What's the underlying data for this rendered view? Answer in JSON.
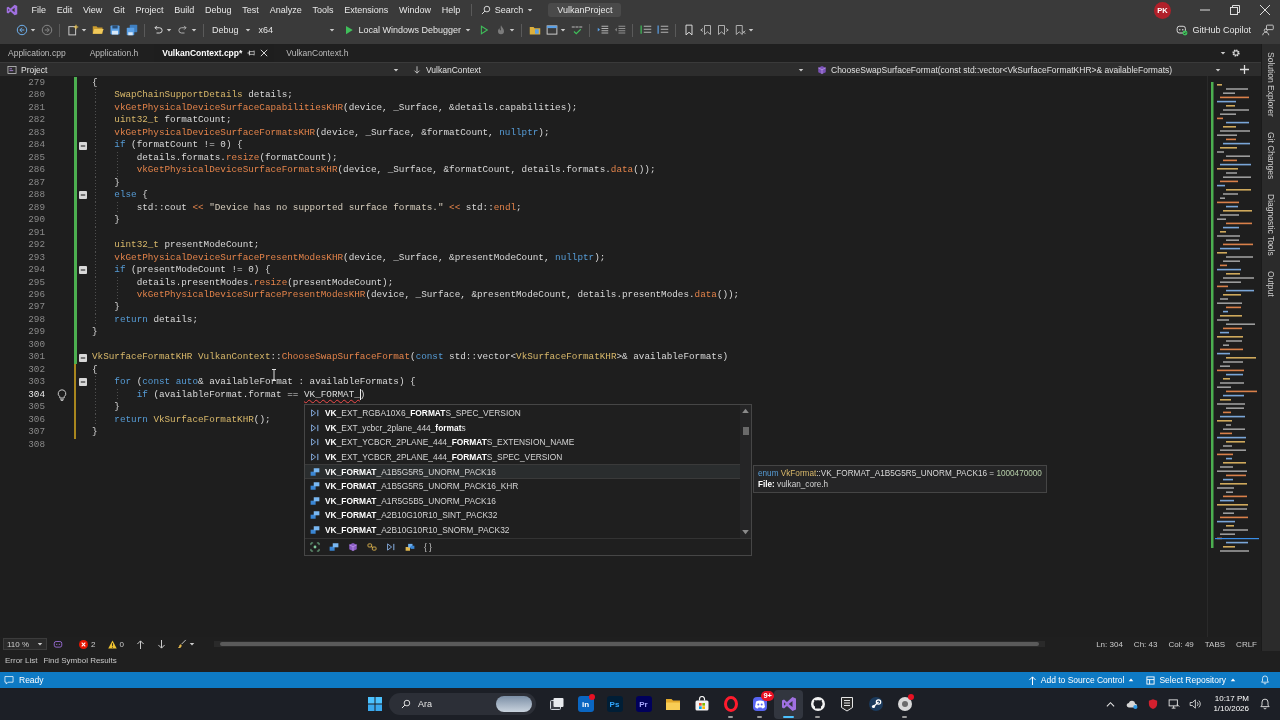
{
  "title_bar": {
    "menu": [
      "File",
      "Edit",
      "View",
      "Git",
      "Project",
      "Build",
      "Debug",
      "Test",
      "Analyze",
      "Tools",
      "Extensions",
      "Window",
      "Help"
    ],
    "search": "Search",
    "solution": "VulkanProject",
    "account": "PK"
  },
  "toolbar": {
    "items": [
      {
        "kind": "back",
        "disabled": false,
        "menu": true
      },
      {
        "kind": "forward",
        "disabled": true,
        "menu": false
      },
      {
        "kind": "separator"
      },
      {
        "kind": "new_item",
        "disabled": false,
        "menu": true
      },
      {
        "kind": "open",
        "disabled": false,
        "menu": false
      },
      {
        "kind": "save",
        "disabled": false,
        "menu": false
      },
      {
        "kind": "save_all",
        "disabled": false,
        "menu": false
      },
      {
        "kind": "separator"
      },
      {
        "kind": "undo",
        "disabled": false,
        "menu": true
      },
      {
        "kind": "redo",
        "disabled": true,
        "menu": true
      },
      {
        "kind": "separator"
      },
      {
        "kind": "combo",
        "label": "Debug"
      },
      {
        "kind": "combo",
        "label": "x64"
      },
      {
        "kind": "run",
        "label": "Local Windows Debugger",
        "menu": true
      },
      {
        "kind": "run_outline",
        "disabled": false,
        "menu": false
      },
      {
        "kind": "hot_reload",
        "disabled": true,
        "menu": true
      },
      {
        "kind": "separator"
      },
      {
        "kind": "solution_folder",
        "disabled": false,
        "menu": false
      },
      {
        "kind": "window",
        "disabled": false,
        "menu": true
      },
      {
        "kind": "spell",
        "disabled": false,
        "menu": false
      },
      {
        "kind": "separator"
      },
      {
        "kind": "indent",
        "disabled": false,
        "menu": false
      },
      {
        "kind": "outdent",
        "disabled": true,
        "menu": false
      },
      {
        "kind": "separator"
      },
      {
        "kind": "comment",
        "disabled": false,
        "menu": false
      },
      {
        "kind": "uncomment",
        "disabled": false,
        "menu": false
      },
      {
        "kind": "separator"
      },
      {
        "kind": "bookmark",
        "disabled": false,
        "menu": false
      },
      {
        "kind": "bookmark_prev",
        "disabled": true,
        "menu": false
      },
      {
        "kind": "bookmark_next",
        "disabled": true,
        "menu": false
      },
      {
        "kind": "bookmark_clear",
        "disabled": true,
        "menu": true
      }
    ],
    "copilot": "GitHub Copilot"
  },
  "tabs": [
    {
      "label": "Application.cpp",
      "selected": false
    },
    {
      "label": "Application.h",
      "selected": false
    },
    {
      "label": "VulkanContext.cpp*",
      "selected": true
    },
    {
      "label": "VulkanContext.h",
      "selected": false
    }
  ],
  "navigation": {
    "project": "Project",
    "scope": "VulkanContext",
    "member": "ChooseSwapSurfaceFormat(const std::vector<VkSurfaceFormatKHR>& availableFormats)"
  },
  "editor": {
    "lines": [
      {
        "number": "279",
        "fold": false,
        "current": false,
        "lightbulb": false,
        "changed": true,
        "saved": true,
        "tokens": [
          {
            "kind": "plain",
            "text": "{"
          }
        ],
        "children": [
          {
            "number": "280",
            "fold": false,
            "current": false,
            "lightbulb": false,
            "changed": true,
            "saved": true,
            "tokens": [
              {
                "kind": "type",
                "text": "SwapChainSupportDetails"
              },
              {
                "kind": "plain",
                "text": " details;"
              }
            ]
          },
          {
            "number": "281",
            "fold": false,
            "current": false,
            "lightbulb": false,
            "changed": true,
            "saved": true,
            "tokens": [
              {
                "kind": "function",
                "text": "vkGetPhysicalDeviceSurfaceCapabilitiesKHR"
              },
              {
                "kind": "plain",
                "text": "(device, _Surface, &details.capabilities);"
              }
            ]
          },
          {
            "number": "282",
            "fold": false,
            "current": false,
            "lightbulb": false,
            "changed": true,
            "saved": true,
            "tokens": [
              {
                "kind": "type",
                "text": "uint32_t"
              },
              {
                "kind": "plain",
                "text": " formatCount;"
              }
            ]
          },
          {
            "number": "283",
            "fold": false,
            "current": false,
            "lightbulb": false,
            "changed": true,
            "saved": true,
            "tokens": [
              {
                "kind": "function",
                "text": "vkGetPhysicalDeviceSurfaceFormatsKHR"
              },
              {
                "kind": "plain",
                "text": "(device, _Surface, &formatCount, "
              },
              {
                "kind": "keyword",
                "text": "nullptr"
              },
              {
                "kind": "plain",
                "text": ");"
              }
            ]
          },
          {
            "number": "284",
            "fold": true,
            "current": false,
            "lightbulb": false,
            "changed": true,
            "saved": true,
            "tokens": [
              {
                "kind": "keyword",
                "text": "if"
              },
              {
                "kind": "plain",
                "text": " (formatCount != 0) {"
              }
            ],
            "children": [
              {
                "number": "285",
                "fold": false,
                "current": false,
                "lightbulb": false,
                "changed": true,
                "saved": true,
                "tokens": [
                  {
                    "kind": "plain",
                    "text": "details.formats."
                  },
                  {
                    "kind": "function",
                    "text": "resize"
                  },
                  {
                    "kind": "plain",
                    "text": "(formatCount);"
                  }
                ]
              },
              {
                "number": "286",
                "fold": false,
                "current": false,
                "lightbulb": false,
                "changed": true,
                "saved": true,
                "tokens": [
                  {
                    "kind": "function",
                    "text": "vkGetPhysicalDeviceSurfaceFormatsKHR"
                  },
                  {
                    "kind": "plain",
                    "text": "(device, _Surface, &formatCount, details.formats."
                  },
                  {
                    "kind": "function",
                    "text": "data"
                  },
                  {
                    "kind": "plain",
                    "text": "());"
                  }
                ]
              }
            ]
          },
          {
            "number": "287",
            "fold": false,
            "current": false,
            "lightbulb": false,
            "changed": true,
            "saved": true,
            "tokens": [
              {
                "kind": "plain",
                "text": "}"
              }
            ]
          },
          {
            "number": "288",
            "fold": true,
            "current": false,
            "lightbulb": false,
            "changed": true,
            "saved": true,
            "tokens": [
              {
                "kind": "keyword",
                "text": "else"
              },
              {
                "kind": "plain",
                "text": " {"
              }
            ],
            "children": [
              {
                "number": "289",
                "fold": false,
                "current": false,
                "lightbulb": false,
                "changed": true,
                "saved": true,
                "tokens": [
                  {
                    "kind": "plain",
                    "text": "std::cout "
                  },
                  {
                    "kind": "operator",
                    "text": "<< "
                  },
                  {
                    "kind": "string",
                    "text": "\"Device has no supported surface formats.\" "
                  },
                  {
                    "kind": "operator",
                    "text": "<<"
                  },
                  {
                    "kind": "plain",
                    "text": " std::"
                  },
                  {
                    "kind": "function",
                    "text": "endl"
                  },
                  {
                    "kind": "plain",
                    "text": ";"
                  }
                ]
              }
            ]
          },
          {
            "number": "290",
            "fold": false,
            "current": false,
            "lightbulb": false,
            "changed": true,
            "saved": true,
            "tokens": [
              {
                "kind": "plain",
                "text": "}"
              }
            ]
          },
          {
            "number": "291",
            "fold": false,
            "current": false,
            "lightbulb": false,
            "changed": true,
            "saved": true
          },
          {
            "number": "292",
            "fold": false,
            "current": false,
            "lightbulb": false,
            "changed": true,
            "saved": true,
            "tokens": [
              {
                "kind": "type",
                "text": "uint32_t"
              },
              {
                "kind": "plain",
                "text": " presentModeCount;"
              }
            ]
          },
          {
            "number": "293",
            "fold": false,
            "current": false,
            "lightbulb": false,
            "changed": true,
            "saved": true,
            "tokens": [
              {
                "kind": "function",
                "text": "vkGetPhysicalDeviceSurfacePresentModesKHR"
              },
              {
                "kind": "plain",
                "text": "(device, _Surface, &presentModeCount, "
              },
              {
                "kind": "keyword",
                "text": "nullptr"
              },
              {
                "kind": "plain",
                "text": ");"
              }
            ]
          },
          {
            "number": "294",
            "fold": true,
            "current": false,
            "lightbulb": false,
            "changed": true,
            "saved": true,
            "tokens": [
              {
                "kind": "keyword",
                "text": "if"
              },
              {
                "kind": "plain",
                "text": " (presentModeCount != 0) {"
              }
            ],
            "children": [
              {
                "number": "295",
                "fold": false,
                "current": false,
                "lightbulb": false,
                "changed": true,
                "saved": true,
                "tokens": [
                  {
                    "kind": "plain",
                    "text": "details.presentModes."
                  },
                  {
                    "kind": "function",
                    "text": "resize"
                  },
                  {
                    "kind": "plain",
                    "text": "(presentModeCount);"
                  }
                ]
              },
              {
                "number": "296",
                "fold": false,
                "current": false,
                "lightbulb": false,
                "changed": true,
                "saved": true,
                "tokens": [
                  {
                    "kind": "function",
                    "text": "vkGetPhysicalDeviceSurfacePresentModesKHR"
                  },
                  {
                    "kind": "plain",
                    "text": "(device, _Surface, &presentModeCount, details.presentModes."
                  },
                  {
                    "kind": "function",
                    "text": "data"
                  },
                  {
                    "kind": "plain",
                    "text": "());"
                  }
                ]
              }
            ]
          },
          {
            "number": "297",
            "fold": false,
            "current": false,
            "lightbulb": false,
            "changed": true,
            "saved": true,
            "tokens": [
              {
                "kind": "plain",
                "text": "}"
              }
            ]
          },
          {
            "number": "298",
            "fold": false,
            "current": false,
            "lightbulb": false,
            "changed": true,
            "saved": true,
            "tokens": [
              {
                "kind": "keyword",
                "text": "return"
              },
              {
                "kind": "plain",
                "text": " details;"
              }
            ]
          }
        ]
      },
      {
        "number": "299",
        "fold": false,
        "current": false,
        "lightbulb": false,
        "changed": true,
        "saved": true,
        "tokens": [
          {
            "kind": "plain",
            "text": "}"
          }
        ]
      },
      {
        "number": "300",
        "fold": false,
        "current": false,
        "lightbulb": false,
        "changed": true,
        "saved": true
      },
      {
        "number": "301",
        "fold": true,
        "current": false,
        "lightbulb": false,
        "changed": true,
        "saved": true,
        "tokens": [
          {
            "kind": "type",
            "text": "VkSurfaceFormatKHR VulkanContext"
          },
          {
            "kind": "plain",
            "text": "::"
          },
          {
            "kind": "function",
            "text": "ChooseSwapSurfaceFormat"
          },
          {
            "kind": "plain",
            "text": "("
          },
          {
            "kind": "keyword",
            "text": "const"
          },
          {
            "kind": "plain",
            "text": " std::vector<"
          },
          {
            "kind": "type",
            "text": "VkSurfaceFormatKHR"
          },
          {
            "kind": "plain",
            "text": ">& availableFormats)"
          }
        ]
      },
      {
        "number": "302",
        "fold": false,
        "current": false,
        "lightbulb": false,
        "changed": true,
        "saved": false,
        "tokens": [
          {
            "kind": "plain",
            "text": "{"
          }
        ],
        "children": [
          {
            "number": "303",
            "fold": true,
            "current": false,
            "lightbulb": false,
            "changed": true,
            "saved": false,
            "tokens": [
              {
                "kind": "keyword",
                "text": "for"
              },
              {
                "kind": "plain",
                "text": " ("
              },
              {
                "kind": "keyword",
                "text": "const auto"
              },
              {
                "kind": "plain",
                "text": "& availableFormat : availableFormats) {"
              }
            ],
            "children": [
              {
                "number": "304",
                "fold": false,
                "current": true,
                "lightbulb": true,
                "changed": true,
                "saved": false,
                "tokens": [
                  {
                    "kind": "keyword",
                    "text": "if"
                  },
                  {
                    "kind": "plain",
                    "text": " (availableFormat.format == "
                  },
                  {
                    "kind": "error",
                    "text": "VK_FORMAT_",
                    "caret": true
                  },
                  {
                    "kind": "plain",
                    "text": ")"
                  }
                ]
              }
            ]
          },
          {
            "number": "305",
            "fold": false,
            "current": false,
            "lightbulb": false,
            "changed": true,
            "saved": false,
            "tokens": [
              {
                "kind": "plain",
                "text": "}"
              }
            ]
          },
          {
            "number": "306",
            "fold": false,
            "current": false,
            "lightbulb": false,
            "changed": true,
            "saved": false,
            "tokens": [
              {
                "kind": "keyword",
                "text": "return "
              },
              {
                "kind": "type",
                "text": "VkSurfaceFormatKHR"
              },
              {
                "kind": "plain",
                "text": "();"
              }
            ]
          }
        ]
      },
      {
        "number": "307",
        "fold": false,
        "current": false,
        "lightbulb": false,
        "changed": true,
        "saved": false,
        "tokens": [
          {
            "kind": "plain",
            "text": "}"
          }
        ]
      },
      {
        "number": "308",
        "fold": false,
        "current": false,
        "lightbulb": false,
        "changed": false
      }
    ]
  },
  "completion": {
    "items": [
      {
        "kind": "constant",
        "label": "**VK**_EXT_RGBA10X6_**FORMAT**S_SPEC_VERSION",
        "selected": false
      },
      {
        "kind": "constant",
        "label": "**VK**_EXT_ycbcr_2plane_444_**format**s",
        "selected": false
      },
      {
        "kind": "constant",
        "label": "**VK**_EXT_YCBCR_2PLANE_444_**FORMAT**S_EXTENSION_NAME",
        "selected": false
      },
      {
        "kind": "constant",
        "label": "**VK**_EXT_YCBCR_2PLANE_444_**FORMAT**S_SPEC_VERSION",
        "selected": false
      },
      {
        "kind": "enum_member",
        "label": "**VK_FORMAT**_A1B5G5R5_UNORM_PACK16",
        "selected": true
      },
      {
        "kind": "enum_member",
        "label": "**VK_FORMAT**_A1B5G5R5_UNORM_PACK16_KHR",
        "selected": false
      },
      {
        "kind": "enum_member",
        "label": "**VK_FORMAT**_A1R5G5B5_UNORM_PACK16",
        "selected": false
      },
      {
        "kind": "enum_member",
        "label": "**VK_FORMAT**_A2B10G10R10_SINT_PACK32",
        "selected": false
      },
      {
        "kind": "enum_member",
        "label": "**VK_FORMAT**_A2B10G10R10_SNORM_PACK32",
        "selected": false
      }
    ],
    "filters": [
      {
        "kind": "all"
      },
      {
        "kind": "enum_member"
      },
      {
        "kind": "class"
      },
      {
        "kind": "link"
      },
      {
        "kind": "constant"
      },
      {
        "kind": "enum"
      },
      {
        "kind": "snippet",
        "label": "{ }"
      }
    ]
  },
  "tooltip": {
    "signature": [
      {
        "kind": "keyword",
        "text": "enum "
      },
      {
        "kind": "type",
        "text": "VkFormat"
      },
      {
        "kind": "plain",
        "text": "::VK_FORMAT_A1B5G5R5_UNORM_PACK16 = "
      },
      {
        "kind": "number",
        "text": "1000470000"
      }
    ],
    "file": "**File:** vulkan_core.h"
  },
  "tool_windows": [
    "Solution Explorer",
    "Git Changes",
    "Diagnostic Tools",
    "Output"
  ],
  "editor_status": {
    "zoom": "110 %",
    "errors": "2",
    "warnings": "0",
    "position": [
      "Ln: 304",
      "Ch: 43",
      "Col: 49"
    ],
    "indentation": "TABS",
    "line_ending": "CRLF"
  },
  "bottom_tabs": [
    "Error List",
    "Find Symbol Results"
  ],
  "status_bar": {
    "message": "Ready",
    "source_control": "Add to Source Control",
    "repository": "Select Repository"
  },
  "taskbar": {
    "search": {
      "placeholder": "Ara"
    },
    "apps": [
      {
        "kind": "task_view",
        "running": false,
        "selected": false,
        "dot": false
      },
      {
        "kind": "linkedin",
        "label": "in",
        "running": false,
        "selected": false,
        "dot": true
      },
      {
        "kind": "photoshop",
        "label": "Ps",
        "running": false,
        "selected": false,
        "dot": false
      },
      {
        "kind": "premiere",
        "label": "Pr",
        "running": false,
        "selected": false,
        "dot": false
      },
      {
        "kind": "explorer",
        "running": false,
        "selected": false,
        "dot": false
      },
      {
        "kind": "store",
        "running": false,
        "selected": false,
        "dot": false
      },
      {
        "kind": "opera",
        "running": true,
        "selected": false,
        "dot": false
      },
      {
        "kind": "discord",
        "badge": "9+",
        "running": true,
        "selected": false,
        "dot": false
      },
      {
        "kind": "visual_studio",
        "running": true,
        "selected": true,
        "dot": false
      },
      {
        "kind": "github",
        "running": true,
        "selected": false,
        "dot": false
      },
      {
        "kind": "epic",
        "running": false,
        "selected": false,
        "dot": false
      },
      {
        "kind": "steam",
        "running": false,
        "selected": false,
        "dot": false
      },
      {
        "kind": "browser",
        "running": true,
        "selected": false,
        "dot": true
      }
    ],
    "clock": {
      "time": "10:17 PM",
      "date": "1/10/2026"
    }
  }
}
